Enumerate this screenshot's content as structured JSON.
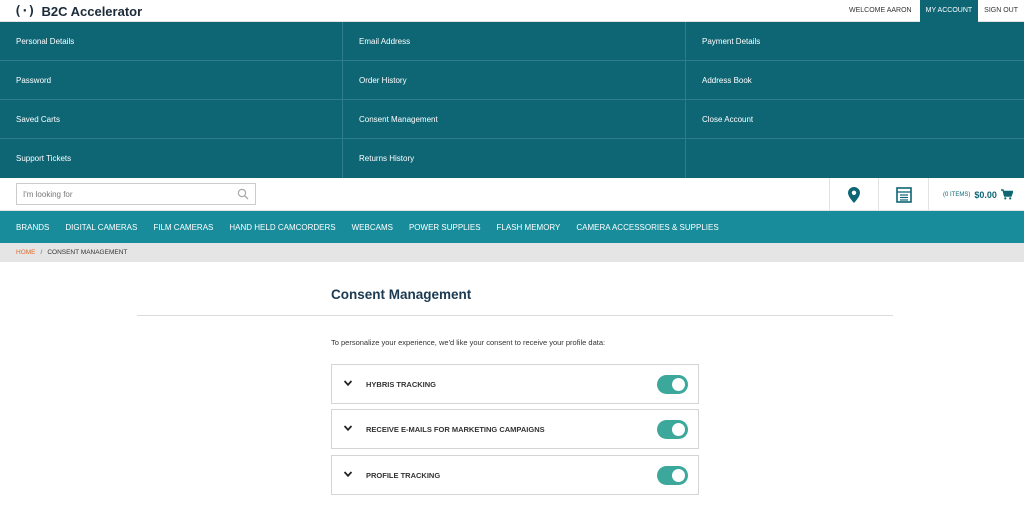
{
  "header": {
    "logo_mark": "(·)",
    "brand": "B2C Accelerator",
    "welcome": "WELCOME AARON",
    "my_account": "MY ACCOUNT",
    "sign_out": "SIGN OUT"
  },
  "account_menu": {
    "items": [
      "Personal Details",
      "Email Address",
      "Payment Details",
      "Password",
      "Order History",
      "Address Book",
      "Saved Carts",
      "Consent Management",
      "Close Account",
      "Support Tickets",
      "Returns History"
    ]
  },
  "search": {
    "placeholder": "I'm looking for",
    "icon": "search-icon"
  },
  "utilities": {
    "store_finder_icon": "map-pin-icon",
    "quick_order_icon": "list-document-icon",
    "cart_count": "(0 ITEMS)",
    "cart_total": "$0.00",
    "cart_icon": "cart-icon"
  },
  "categories": [
    "BRANDS",
    "DIGITAL CAMERAS",
    "FILM CAMERAS",
    "HAND HELD CAMCORDERS",
    "WEBCAMS",
    "POWER SUPPLIES",
    "FLASH MEMORY",
    "CAMERA ACCESSORIES & SUPPLIES"
  ],
  "breadcrumb": {
    "home": "HOME",
    "separator": "/",
    "current": "CONSENT MANAGEMENT"
  },
  "page": {
    "title": "Consent Management",
    "intro": "To personalize your experience, we'd like your consent to receive your profile data:"
  },
  "consents": [
    {
      "label": "HYBRIS TRACKING",
      "enabled": true
    },
    {
      "label": "RECEIVE E-MAILS FOR MARKETING CAMPAIGNS",
      "enabled": true
    },
    {
      "label": "PROFILE TRACKING",
      "enabled": true
    }
  ],
  "colors": {
    "menu_bg": "#0e6675",
    "nav_bg": "#188c9b",
    "toggle_on": "#3ba89b",
    "crumb_home": "#e06a2b"
  }
}
